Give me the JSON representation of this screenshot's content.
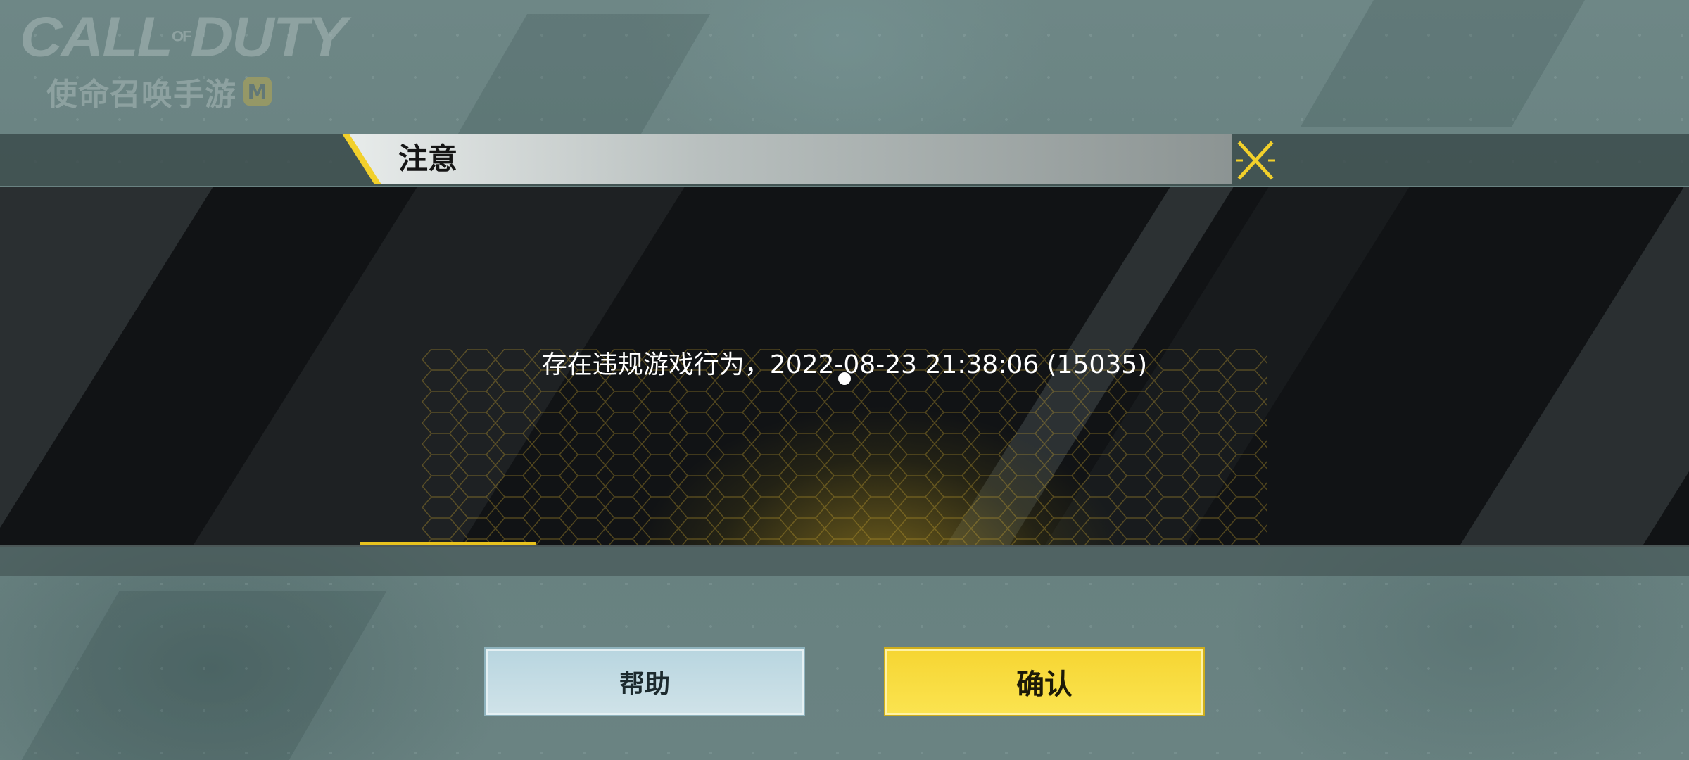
{
  "logo": {
    "main": "CALL",
    "of": "OF",
    "duty": "DUTY",
    "subtitle": "使命召唤手游",
    "badge": "M"
  },
  "dialog": {
    "title": "注意",
    "message": "存在违规游戏行为，2022-08-23 21:38:06 (15035)",
    "close_icon": "close-x-icon"
  },
  "buttons": {
    "help_label": "帮助",
    "confirm_label": "确认"
  },
  "colors": {
    "accent_yellow": "#f2d02b",
    "confirm_bg": "#f6d633",
    "help_bg": "#b9d6e0",
    "dialog_bg": "#111315"
  }
}
